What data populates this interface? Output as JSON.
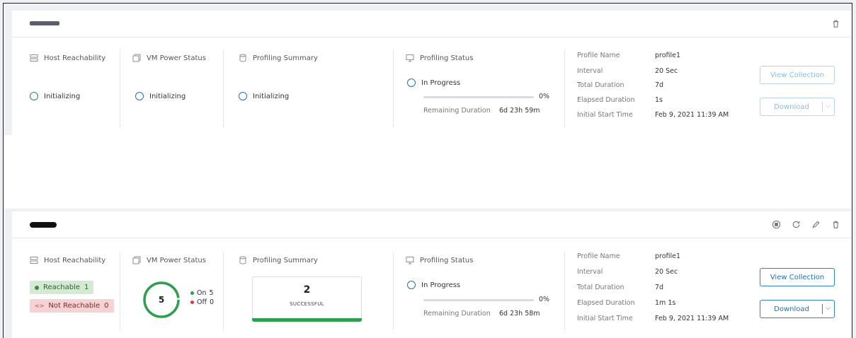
{
  "cards": [
    {
      "host_reachability": {
        "title": "Host Reachability",
        "status": "Initializing"
      },
      "vm_power_status": {
        "title": "VM Power Status",
        "status": "Initializing"
      },
      "profiling_summary": {
        "title": "Profiling Summary",
        "status": "Initializing"
      },
      "profiling_status": {
        "title": "Profiling Status",
        "state": "In Progress",
        "percent": "0%",
        "progress": 0,
        "remaining_label": "Remaining Duration",
        "remaining_value": "6d 23h 59m"
      },
      "details": {
        "profile_name_label": "Profile Name",
        "profile_name": "profile1",
        "interval_label": "Interval",
        "interval": "20 Sec",
        "total_duration_label": "Total Duration",
        "total_duration": "7d",
        "elapsed_duration_label": "Elapsed Duration",
        "elapsed_duration": "1s",
        "initial_start_label": "Initial Start Time",
        "initial_start": "Feb 9, 2021 11:39 AM"
      },
      "buttons": {
        "view_collection": "View Collection",
        "download": "Download"
      },
      "header_icons": [
        "trash-icon"
      ]
    },
    {
      "host_reachability": {
        "title": "Host Reachability",
        "reachable_label": "Reachable",
        "reachable_count": "1",
        "not_reachable_label": "Not Reachable",
        "not_reachable_count": "0"
      },
      "vm_power_status": {
        "title": "VM Power Status",
        "total": "5",
        "on_label": "On",
        "on_count": "5",
        "off_label": "Off",
        "off_count": "0"
      },
      "profiling_summary": {
        "title": "Profiling Summary",
        "count": "2",
        "label": "SUCCESSFUL"
      },
      "profiling_status": {
        "title": "Profiling Status",
        "state": "In Progress",
        "percent": "0%",
        "progress": 0,
        "remaining_label": "Remaining Duration",
        "remaining_value": "6d 23h 58m"
      },
      "details": {
        "profile_name_label": "Profile Name",
        "profile_name": "profile1",
        "interval_label": "Interval",
        "interval": "20 Sec",
        "total_duration_label": "Total Duration",
        "total_duration": "7d",
        "elapsed_duration_label": "Elapsed Duration",
        "elapsed_duration": "1m 1s",
        "initial_start_label": "Initial Start Time",
        "initial_start": "Feb 9, 2021 11:39 AM"
      },
      "buttons": {
        "view_collection": "View Collection",
        "download": "Download"
      },
      "header_icons": [
        "stop-icon",
        "refresh-icon",
        "edit-icon",
        "trash-icon"
      ]
    }
  ],
  "colors": {
    "accent": "#2f7fc9",
    "success": "#2e9e4f",
    "reachable_bg": "#d4ead3",
    "not_reachable_bg": "#f6d3d3",
    "off_dot": "#e03a3a"
  }
}
